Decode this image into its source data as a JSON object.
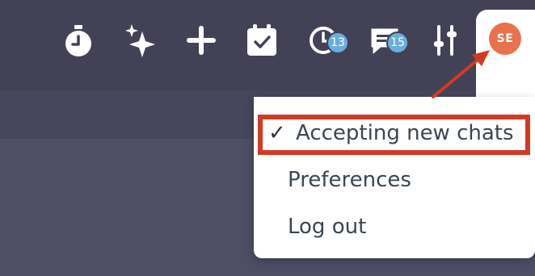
{
  "toolbar": {
    "icons": [
      {
        "name": "stopwatch-icon"
      },
      {
        "name": "sparkle-icon"
      },
      {
        "name": "plus-icon"
      },
      {
        "name": "calendar-check-icon"
      },
      {
        "name": "clock-history-icon",
        "badge": "13"
      },
      {
        "name": "chat-icon",
        "badge": "15"
      },
      {
        "name": "sliders-icon"
      }
    ],
    "avatar_initials": "SE"
  },
  "menu": {
    "items": [
      {
        "label": "Accepting new chats",
        "checked": true
      },
      {
        "label": "Preferences"
      },
      {
        "label": "Log out"
      }
    ],
    "check_mark": "✓"
  },
  "colors": {
    "topbar": "#434156",
    "badge": "#6aaedc",
    "avatar": "#e8724e",
    "highlight": "#d23a24"
  }
}
